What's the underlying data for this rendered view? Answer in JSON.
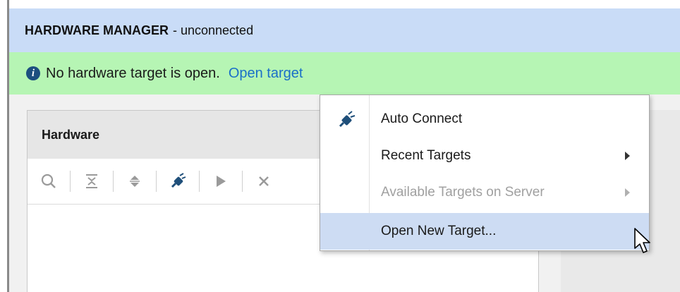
{
  "header": {
    "title_bold": "HARDWARE MANAGER",
    "title_rest": "- unconnected"
  },
  "info_bar": {
    "icon": "info-icon",
    "message": "No hardware target is open.",
    "link": "Open target"
  },
  "hardware_panel": {
    "title": "Hardware",
    "toolbar": [
      "search-icon",
      "collapse-all-icon",
      "expand-all-icon",
      "auto-connect-icon",
      "run-icon",
      "close-icon"
    ]
  },
  "context_menu": {
    "items": [
      {
        "label": "Auto Connect",
        "icon": "auto-connect-icon",
        "submenu": false,
        "enabled": true,
        "highlighted": false
      },
      {
        "label": "Recent Targets",
        "submenu": true,
        "enabled": true,
        "highlighted": false
      },
      {
        "label": "Available Targets on Server",
        "submenu": true,
        "enabled": false,
        "highlighted": false
      },
      {
        "label": "Open New Target...",
        "submenu": false,
        "enabled": true,
        "highlighted": true
      }
    ]
  },
  "colors": {
    "header_bg": "#c9dcf7",
    "info_bg": "#b6f5b4",
    "link": "#1a6fc8",
    "highlight": "#cddcf3"
  }
}
